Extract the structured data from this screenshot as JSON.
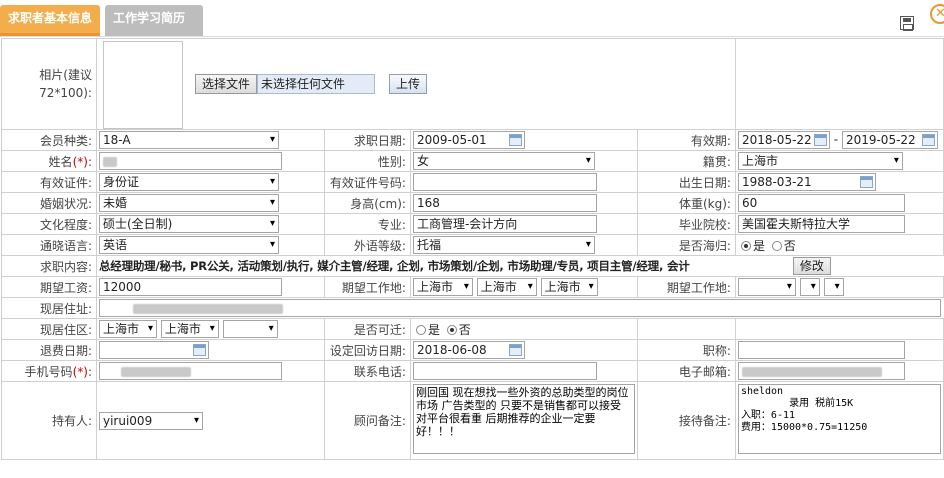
{
  "tabs": {
    "basic_info": "求职者基本信息",
    "resume": "工作学习简历"
  },
  "photo": {
    "label_line1": "相片(建议",
    "label_line2": "72*100):",
    "choose_file": "选择文件",
    "no_file": "未选择任何文件",
    "upload": "上传"
  },
  "row_member": {
    "member_type_label": "会员种类:",
    "member_type": "18-A",
    "apply_date_label": "求职日期:",
    "apply_date": "2009-05-01",
    "valid_label": "有效期:",
    "valid_from": "2018-05-22",
    "valid_sep": "-",
    "valid_to": "2019-05-22"
  },
  "row_name": {
    "name_label": "姓名",
    "required_mark": "(*)",
    "colon": ":",
    "gender_label": "性别:",
    "gender": "女",
    "origin_label": "籍贯:",
    "origin": "上海市"
  },
  "row_id": {
    "id_type_label": "有效证件:",
    "id_type": "身份证",
    "id_no_label": "有效证件号码:",
    "id_no": "",
    "birth_label": "出生日期:",
    "birth": "1988-03-21"
  },
  "row_marital": {
    "marital_label": "婚姻状况:",
    "marital": "未婚",
    "height_label": "身高(cm):",
    "height": "168",
    "weight_label": "体重(kg):",
    "weight": "60"
  },
  "row_edu": {
    "edu_label": "文化程度:",
    "edu": "硕士(全日制)",
    "major_label": "专业:",
    "major": "工商管理-会计方向",
    "school_label": "毕业院校:",
    "school": "美国霍夫斯特拉大学"
  },
  "row_lang": {
    "lang_label": "通晓语言:",
    "lang": "英语",
    "lang_level_label": "外语等级:",
    "lang_level": "托福",
    "returnee_label": "是否海归:",
    "returnee_yes": "是",
    "returnee_no": "否"
  },
  "row_jobs": {
    "label": "求职内容:",
    "content": "总经理助理/秘书, PR公关, 活动策划/执行, 媒介主管/经理, 企划, 市场策划/企划, 市场助理/专员, 项目主管/经理, 会计",
    "edit": "修改"
  },
  "row_salary": {
    "salary_label": "期望工资:",
    "salary": "12000",
    "place_label": "期望工作地:",
    "place1": "上海市",
    "place2": "上海市",
    "place3": "上海市",
    "place2_label": "期望工作地:"
  },
  "row_address": {
    "label": "现居住址:"
  },
  "row_area": {
    "label": "现居住区:",
    "area1": "上海市",
    "area2": "上海市",
    "relocate_label": "是否可迁:",
    "relocate_yes": "是",
    "relocate_no": "否"
  },
  "row_refund": {
    "refund_label": "退费日期:",
    "visit_label": "设定回访日期:",
    "visit_date": "2018-06-08",
    "title_label": "职称:"
  },
  "row_phone": {
    "mobile_label": "手机号码",
    "required_mark": "(*)",
    "colon": ":",
    "phone_label": "联系电话:",
    "email_label": "电子邮箱:"
  },
  "row_notes": {
    "owner_label": "持有人:",
    "owner": "yirui009",
    "advisor_label": "顾问备注:",
    "advisor_note": "刚回国 现在想找一些外资的总助类型的岗位 市场 广告类型的 只要不是销售都可以接受\n对平台很看重 后期推荐的企业一定要好！！！",
    "reception_label": "接待备注:",
    "reception_note": "sheldon\n        录用 税前15K\n入职：6-11\n费用：15000*0.75=11250"
  }
}
